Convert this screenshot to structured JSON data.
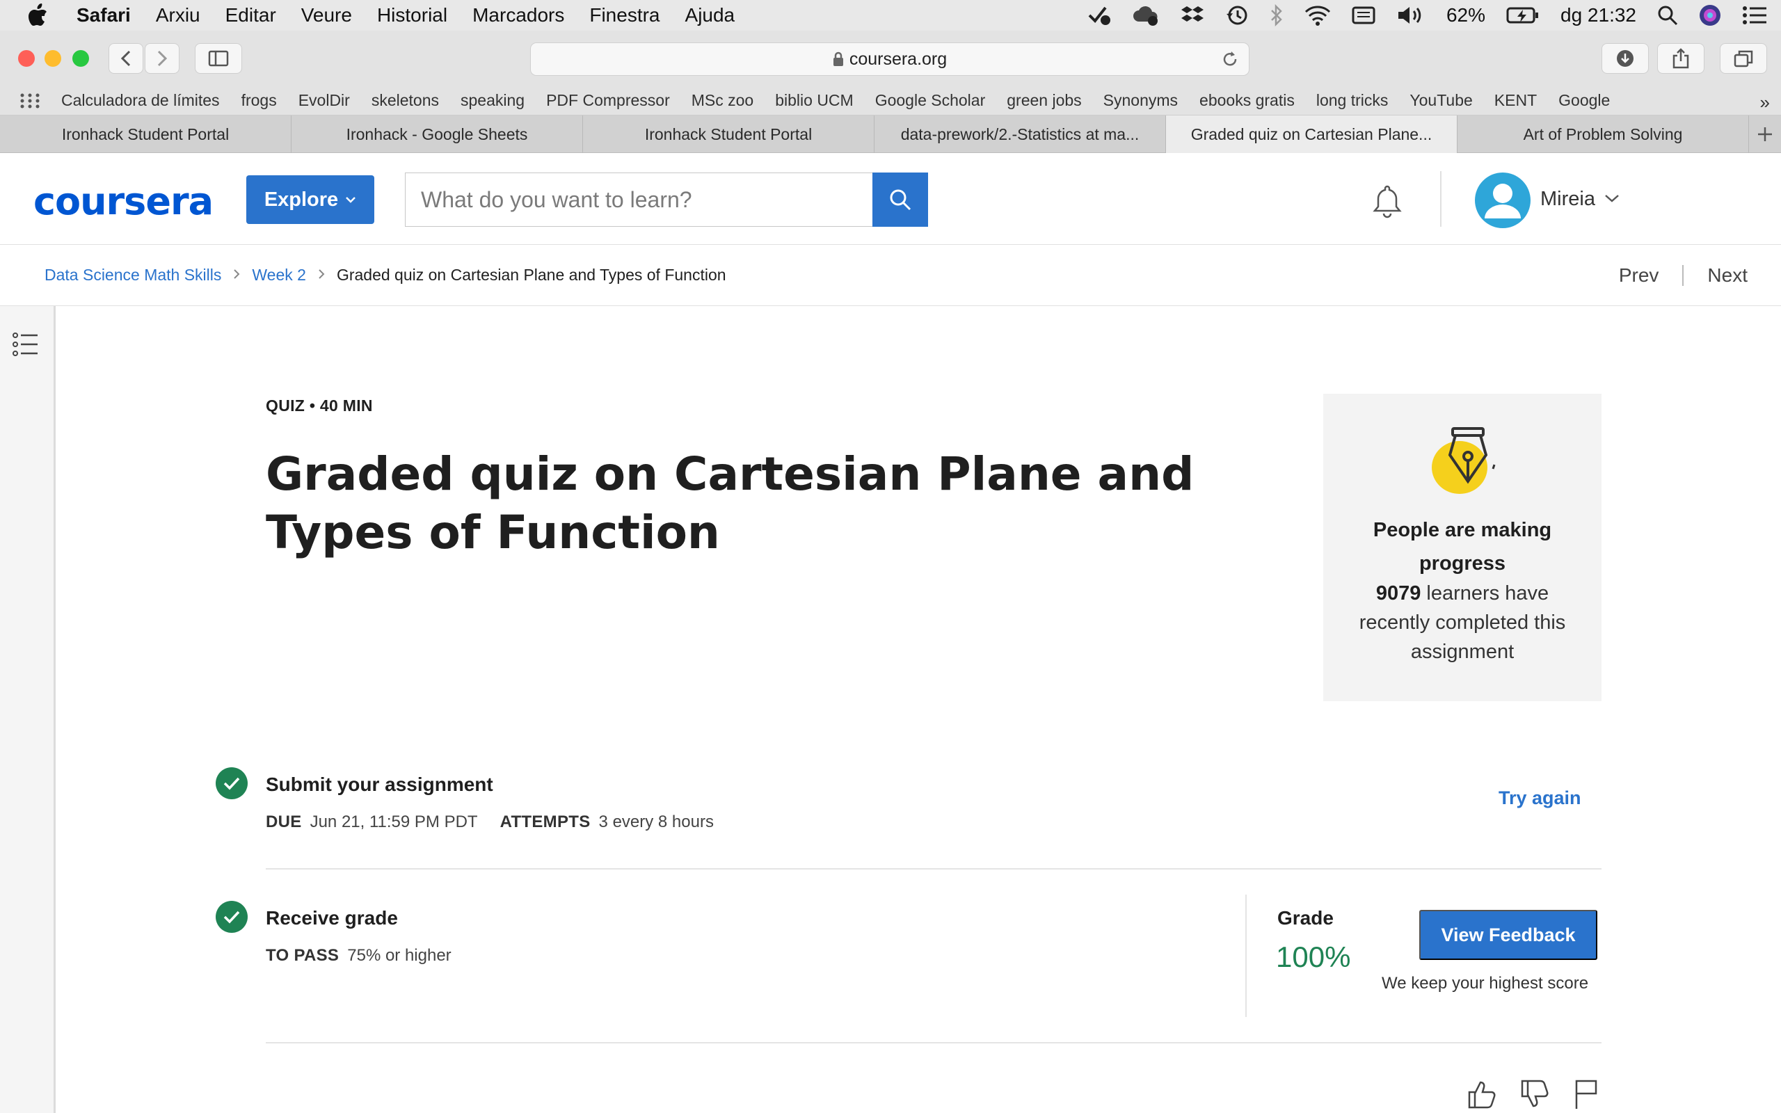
{
  "menubar": {
    "items": [
      "Safari",
      "Arxiu",
      "Editar",
      "Veure",
      "Historial",
      "Marcadors",
      "Finestra",
      "Ajuda"
    ],
    "battery": "62%",
    "clock": "dg 21:32"
  },
  "browser": {
    "url": "coursera.org",
    "bookmarks": [
      "Calculadora de límites",
      "frogs",
      "EvolDir",
      "skeletons",
      "speaking",
      "PDF Compressor",
      "MSc zoo",
      "biblio UCM",
      "Google Scholar",
      "green jobs",
      "Synonyms",
      "ebooks gratis",
      "long tricks",
      "YouTube",
      "KENT",
      "Google"
    ],
    "tabs": [
      {
        "label": "Ironhack Student Portal",
        "active": false
      },
      {
        "label": "Ironhack - Google Sheets",
        "active": false
      },
      {
        "label": "Ironhack Student Portal",
        "active": false
      },
      {
        "label": "data-prework/2.-Statistics at ma...",
        "active": false
      },
      {
        "label": "Graded quiz on Cartesian Plane...",
        "active": true
      },
      {
        "label": "Art of Problem Solving",
        "active": false
      }
    ]
  },
  "header": {
    "logo": "coursera",
    "explore": "Explore",
    "search_placeholder": "What do you want to learn?",
    "username": "Mireia"
  },
  "breadcrumb": {
    "course": "Data Science Math Skills",
    "week": "Week 2",
    "current": "Graded quiz on Cartesian Plane and Types of Function",
    "prev": "Prev",
    "next": "Next"
  },
  "quiz": {
    "meta": "QUIZ • 40 MIN",
    "title": "Graded quiz on Cartesian Plane and Types of Function"
  },
  "progress_card": {
    "heading": "People are making progress",
    "count": "9079",
    "text": "learners have recently completed this assignment"
  },
  "submit": {
    "title": "Submit your assignment",
    "due_label": "DUE",
    "due_value": "Jun 21, 11:59 PM PDT",
    "attempts_label": "ATTEMPTS",
    "attempts_value": "3 every 8 hours",
    "try_again": "Try again"
  },
  "grade": {
    "title": "Receive grade",
    "pass_label": "TO PASS",
    "pass_value": "75% or higher",
    "grade_label": "Grade",
    "grade_value": "100%",
    "view_feedback": "View Feedback",
    "keep_score": "We keep your highest score"
  },
  "colors": {
    "brand_blue": "#2a73cc",
    "success_green": "#1f8354"
  }
}
